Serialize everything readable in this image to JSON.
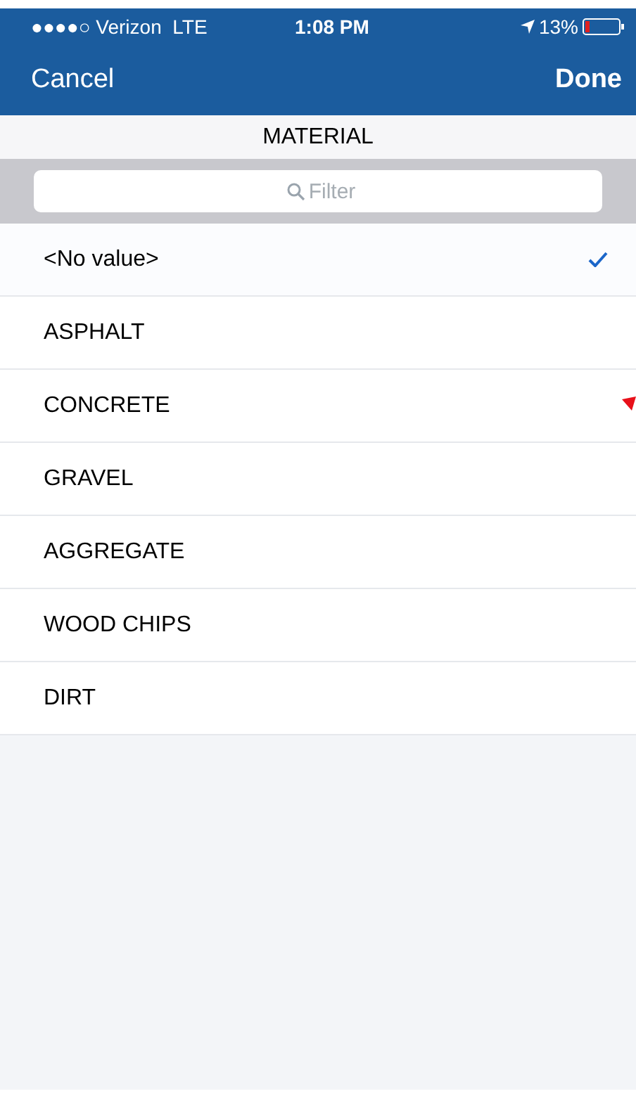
{
  "status_bar": {
    "carrier": "●●●●○ Verizon  LTE",
    "time": "1:08 PM",
    "battery": "13%"
  },
  "nav": {
    "cancel": "Cancel",
    "done": "Done"
  },
  "title": "MATERIAL",
  "search": {
    "placeholder": "Filter"
  },
  "items": [
    {
      "label": "<No value>",
      "selected": true
    },
    {
      "label": "ASPHALT",
      "selected": false
    },
    {
      "label": "CONCRETE",
      "selected": false,
      "marker": true
    },
    {
      "label": "GRAVEL",
      "selected": false
    },
    {
      "label": "AGGREGATE",
      "selected": false
    },
    {
      "label": "WOOD CHIPS",
      "selected": false
    },
    {
      "label": "DIRT",
      "selected": false
    }
  ]
}
